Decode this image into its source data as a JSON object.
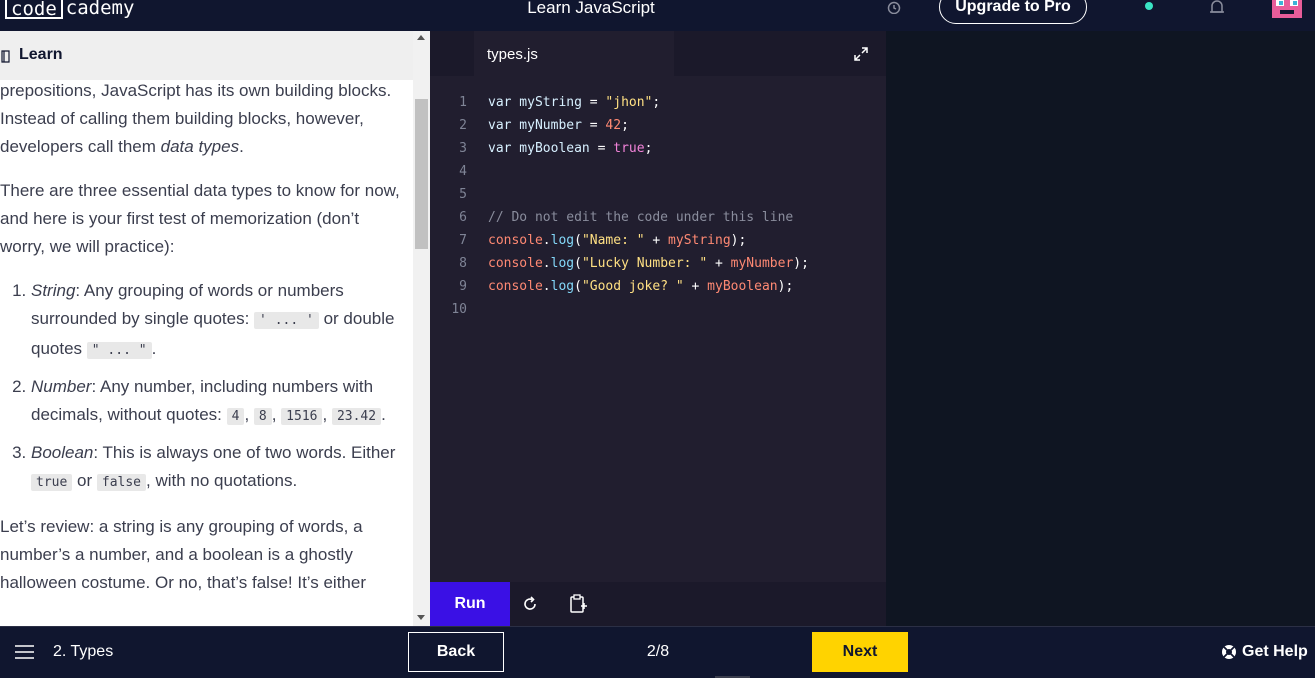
{
  "app": {
    "logo_box": "code",
    "logo_rest": "cademy",
    "course_title": "Learn JavaScript",
    "upgrade_label": "Upgrade to Pro"
  },
  "learn": {
    "header_label": "Learn",
    "p1_a": "prepositions, JavaScript has its own building blocks. Instead of calling them building blocks, however, developers call them ",
    "p1_em": "data types",
    "p1_b": ".",
    "p2": "There are three essential data types to know for now, and here is your first test of memorization (don’t worry, we will practice):",
    "items": [
      {
        "term": "String",
        "text_a": ": Any grouping of words or numbers surrounded by single quotes: ",
        "code1": "' ... '",
        "text_b": " or double quotes ",
        "code2": "\" ... \"",
        "text_c": "."
      },
      {
        "term": "Number",
        "text_a": ": Any number, including numbers with decimals, without quotes: ",
        "code1": "4",
        "sep1": ", ",
        "code2": "8",
        "sep2": ", ",
        "code3": "1516",
        "sep3": ", ",
        "code4": "23.42",
        "text_b": "."
      },
      {
        "term": "Boolean",
        "text_a": ": This is always one of two words. Either ",
        "code1": "true",
        "text_b": " or ",
        "code2": "false",
        "text_c": ", with no quotations."
      }
    ],
    "p3": "Let’s review: a string is any grouping of words, a number’s a number, and a boolean is a ghostly halloween costume. Or no, that’s false! It’s either"
  },
  "editor": {
    "file_name": "types.js",
    "line_numbers": [
      "1",
      "2",
      "3",
      "4",
      "5",
      "6",
      "7",
      "8",
      "9",
      "10"
    ],
    "code": {
      "l1": {
        "kw": "var",
        "name": " myString",
        "op": " = ",
        "val": "\"jhon\"",
        "end": ";"
      },
      "l2": {
        "kw": "var",
        "name": " myNumber",
        "op": " = ",
        "val": "42",
        "end": ";"
      },
      "l3": {
        "kw": "var",
        "name": " myBoolean",
        "op": " = ",
        "val": "true",
        "end": ";"
      },
      "l6": "// Do not edit the code under this line",
      "l7": {
        "obj": "console",
        "dot": ".",
        "mth": "log",
        "open": "(",
        "str": "\"Name: \"",
        "plus": " + ",
        "arg": "myString",
        "close": ");"
      },
      "l8": {
        "obj": "console",
        "dot": ".",
        "mth": "log",
        "open": "(",
        "str": "\"Lucky Number: \"",
        "plus": " + ",
        "arg": "myNumber",
        "close": ");"
      },
      "l9": {
        "obj": "console",
        "dot": ".",
        "mth": "log",
        "open": "(",
        "str": "\"Good joke? \"",
        "plus": " + ",
        "arg": "myBoolean",
        "close": ");"
      }
    },
    "run_label": "Run"
  },
  "footer": {
    "lesson_label": "2. Types",
    "back_label": "Back",
    "progress": "2/8",
    "next_label": "Next",
    "help_label": "Get Help"
  },
  "icons": {
    "clock": "clock-icon",
    "bell": "bell-icon",
    "book": "book-icon",
    "expand": "expand-icon",
    "reset": "reset-icon",
    "copy": "copy-icon",
    "menu": "menu-icon",
    "help": "help-icon"
  },
  "colors": {
    "navy": "#10162f",
    "run_button": "#3a10e5",
    "next_button": "#ffd300",
    "status_dot": "#3ae4c4",
    "editor_bg": "#211e2f"
  }
}
